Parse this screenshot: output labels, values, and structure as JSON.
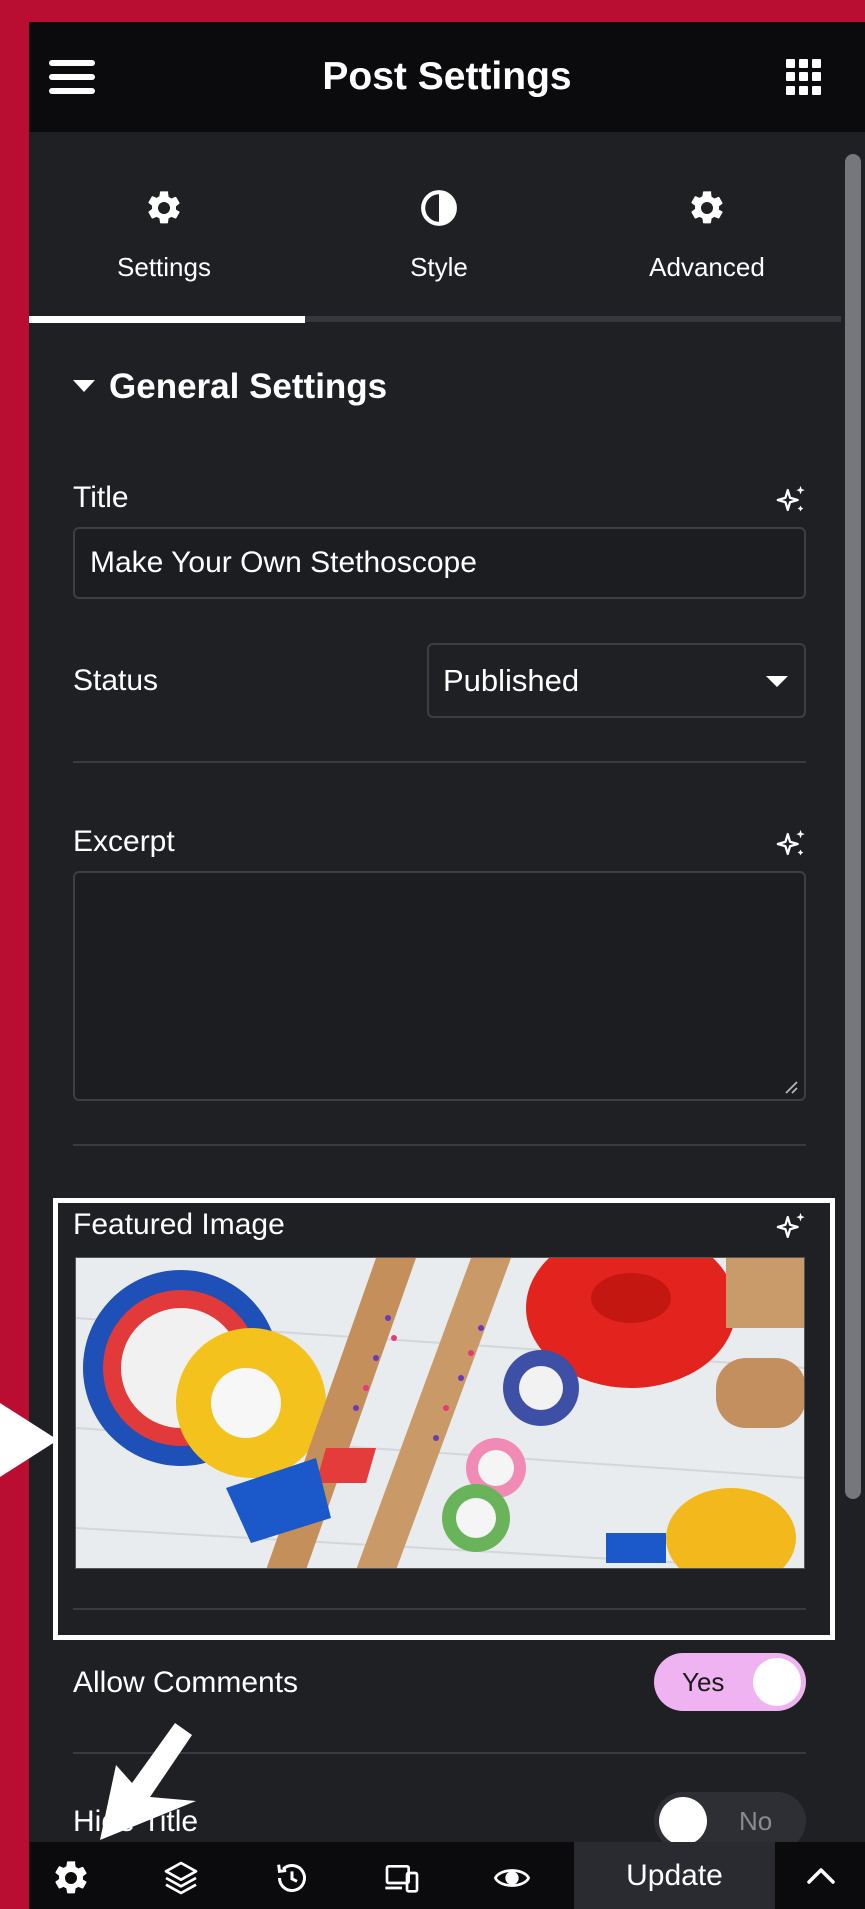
{
  "topbar": {
    "title": "Post Settings",
    "menu_icon": "hamburger-menu-icon",
    "apps_icon": "grid-apps-icon"
  },
  "tabs": [
    {
      "label": "Settings",
      "icon": "gear-icon",
      "active": true
    },
    {
      "label": "Style",
      "icon": "half-circle-contrast-icon",
      "active": false
    },
    {
      "label": "Advanced",
      "icon": "gear-icon",
      "active": false
    }
  ],
  "section": {
    "heading": "General Settings",
    "expanded": true
  },
  "fields": {
    "title_label": "Title",
    "title_value": "Make Your Own Stethoscope",
    "status_label": "Status",
    "status_value": "Published",
    "excerpt_label": "Excerpt",
    "excerpt_value": "",
    "featured_image_label": "Featured Image",
    "featured_image_alt": "Cardboard tubes with glitter, tape rolls and plastic funnels",
    "allow_comments_label": "Allow Comments",
    "allow_comments_value": "Yes",
    "hide_title_label": "Hide Title",
    "hide_title_value": "No",
    "ai_icon": "sparkle-ai-icon"
  },
  "bottombar": {
    "update_label": "Update",
    "icons": [
      "gear-icon",
      "layers-icon",
      "history-icon",
      "responsive-devices-icon",
      "eye-preview-icon",
      "chevron-up-icon"
    ]
  },
  "colors": {
    "background": "#b90e31",
    "panel": "#1f2024",
    "topbar": "#0b0b0d",
    "toggle_on": "#f0b3f1"
  }
}
